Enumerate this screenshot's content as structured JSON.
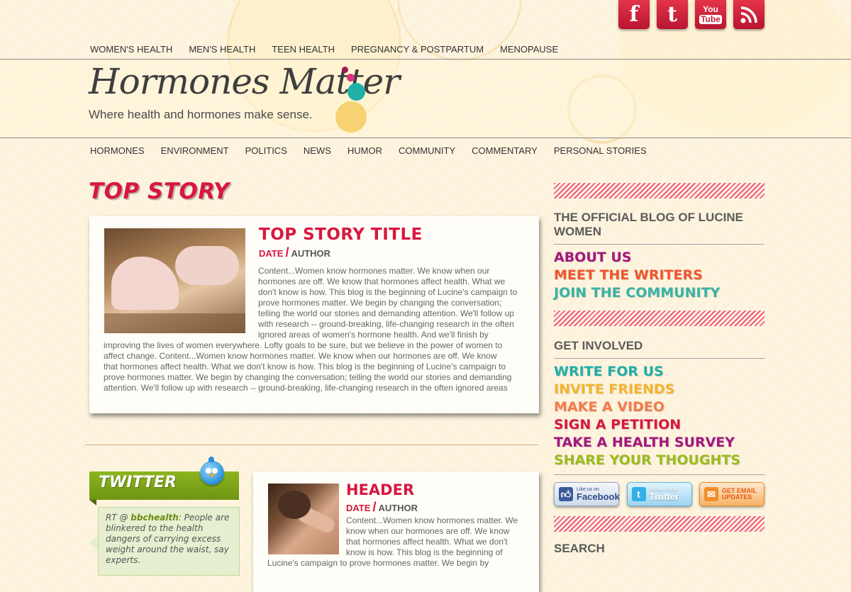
{
  "social": {
    "facebook": "f",
    "twitter": "t",
    "youtube_top": "You",
    "youtube_bottom": "Tube",
    "rss": "rss-icon"
  },
  "top_nav": [
    "WOMEN'S HEALTH",
    "MEN'S HEALTH",
    "TEEN HEALTH",
    "PREGNANCY & POSTPARTUM",
    "MENOPAUSE"
  ],
  "logo": {
    "name": "Hormones Matter",
    "tagline": "Where health and hormones make sense."
  },
  "main_nav": [
    "HORMONES",
    "ENVIRONMENT",
    "POLITICS",
    "NEWS",
    "HUMOR",
    "COMMUNITY",
    "COMMENTARY",
    "PERSONAL STORIES"
  ],
  "top_story": {
    "section_title": "TOP STORY",
    "title": "TOP STORY TITLE",
    "date": "DATE",
    "author": "AUTHOR",
    "lines": [
      "Content...Women know hormones matter. We know when our",
      "hormones are off. We know that hormones affect health. What we",
      "don't know is how. This blog is the beginning of Lucine's campaign to",
      "prove hormones matter. We begin by changing the conversation;",
      "telling the world our stories and demanding attention. We'll follow up",
      "with research -- ground-breaking, life-changing research in the often",
      "ignored areas of women's hormone health. And we'll finish by",
      "improving the lives of women everywhere. Lofty goals to be sure, but we believe in the power of women to",
      "affect change. Content...Women know hormones matter. We know when our hormones are off. We know",
      "that hormones affect health. What we don't know is how. This blog is the beginning of Lucine's campaign to",
      "prove hormones matter. We begin by changing the conversation; telling the world our stories and demanding",
      "attention. We'll follow up with research -- ground-breaking, life-changing research in the often ignored areas"
    ]
  },
  "twitter": {
    "label": "TWITTER",
    "prefix": "RT @ ",
    "handle": "bbchealth",
    "text": ": People are blinkered to the health dangers of carrying excess weight around the waist, say experts."
  },
  "post": {
    "title": "HEADER",
    "date": "DATE",
    "author": "AUTHOR",
    "lines": [
      "Content...Women know hormones matter. We",
      "know when our hormones are off. We know",
      "that hormones affect health. What we don't",
      "know is how. This blog is the beginning of",
      "Lucine's campaign to prove hormones matter. We begin by"
    ]
  },
  "sidebar": {
    "official_heading": "THE OFFICIAL BLOG OF LUCINE WOMEN",
    "about_links": [
      {
        "label": "ABOUT US",
        "color": "#a3177f"
      },
      {
        "label": "MEET THE WRITERS",
        "color": "#f2562d"
      },
      {
        "label": "JOIN THE COMMUNITY",
        "color": "#38b3a6"
      }
    ],
    "involved_heading": "GET INVOLVED",
    "involved_links": [
      {
        "label": "WRITE FOR US",
        "color": "#1fb0a7"
      },
      {
        "label": "INVITE FRIENDS",
        "color": "#f6b52e"
      },
      {
        "label": "MAKE A VIDEO",
        "color": "#f47b4a"
      },
      {
        "label": "SIGN A PETITION",
        "color": "#d8173f"
      },
      {
        "label": "TAKE A HEALTH SURVEY",
        "color": "#a3177f"
      },
      {
        "label": "SHARE YOUR THOUGHTS",
        "color": "#9bbb1e"
      }
    ],
    "facebook_small": "Like us on",
    "facebook_big": "Facebook",
    "twitter_small": "Follow us on",
    "twitter_big": "Twitter",
    "email_small": "GET EMAIL",
    "email_big": "UPDATES",
    "search_heading": "SEARCH"
  }
}
